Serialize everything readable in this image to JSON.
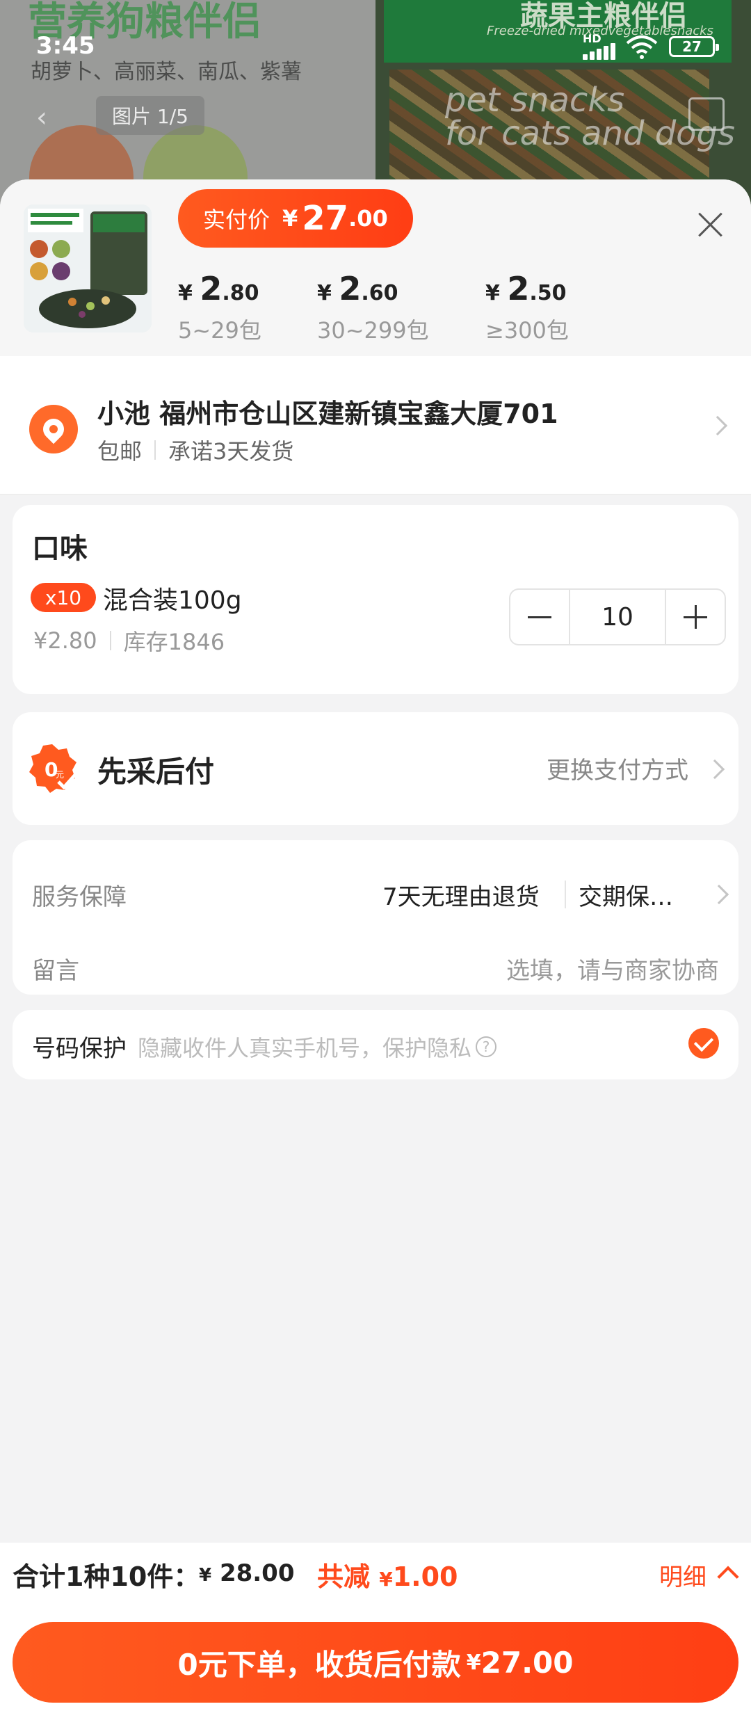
{
  "background": {
    "title": "营养狗粮伴侣",
    "subtitle": "胡萝卜、高丽菜、南瓜、紫薯",
    "right_title": "蔬果主粮伴侣",
    "right_sub": "Freeze-dried mixedvegetablesnacks",
    "pet_text_1": "pet snacks",
    "pet_text_2": "for cats and dogs",
    "image_counter": "图片 1/5"
  },
  "status_bar": {
    "time": "3:45",
    "network": "HD",
    "battery": "27"
  },
  "sheet_header": {
    "pay_label": "实付价",
    "currency": "¥",
    "pay_int": "27",
    "pay_dec": ".00",
    "tiers": [
      {
        "currency": "¥",
        "int": "2",
        "dec": ".80",
        "qty": "5~29包"
      },
      {
        "currency": "¥",
        "int": "2",
        "dec": ".60",
        "qty": "30~299包"
      },
      {
        "currency": "¥",
        "int": "2",
        "dec": ".50",
        "qty": "≥300包"
      }
    ]
  },
  "address": {
    "main": "小池 福州市仓山区建新镇宝鑫大厦701",
    "shipping": "包邮",
    "promise": "承诺3天发货"
  },
  "flavor": {
    "title": "口味",
    "badge": "x10",
    "variant": "混合装100g",
    "unit_price": "¥2.80",
    "stock": "库存1846",
    "quantity": "10"
  },
  "payment": {
    "title": "先采后付",
    "change": "更换支付方式"
  },
  "service": {
    "label": "服务保障",
    "value_1": "7天无理由退货",
    "value_2": "交期保…",
    "note_label": "留言",
    "note_hint": "选填，请与商家协商"
  },
  "number_protect": {
    "label": "号码保护",
    "desc": "隐藏收件人真实手机号，保护隐私",
    "help": "?"
  },
  "bottom_bar": {
    "summary": "合计1种10件：",
    "currency": "¥",
    "total": "28.00",
    "save_label": "共减",
    "save": "1.00",
    "detail": "明细",
    "submit_label": "0元下单，收货后付款",
    "submit_amount": "27.00"
  },
  "colors": {
    "accent": "#ff4a1c",
    "background": "#f3f3f4"
  }
}
